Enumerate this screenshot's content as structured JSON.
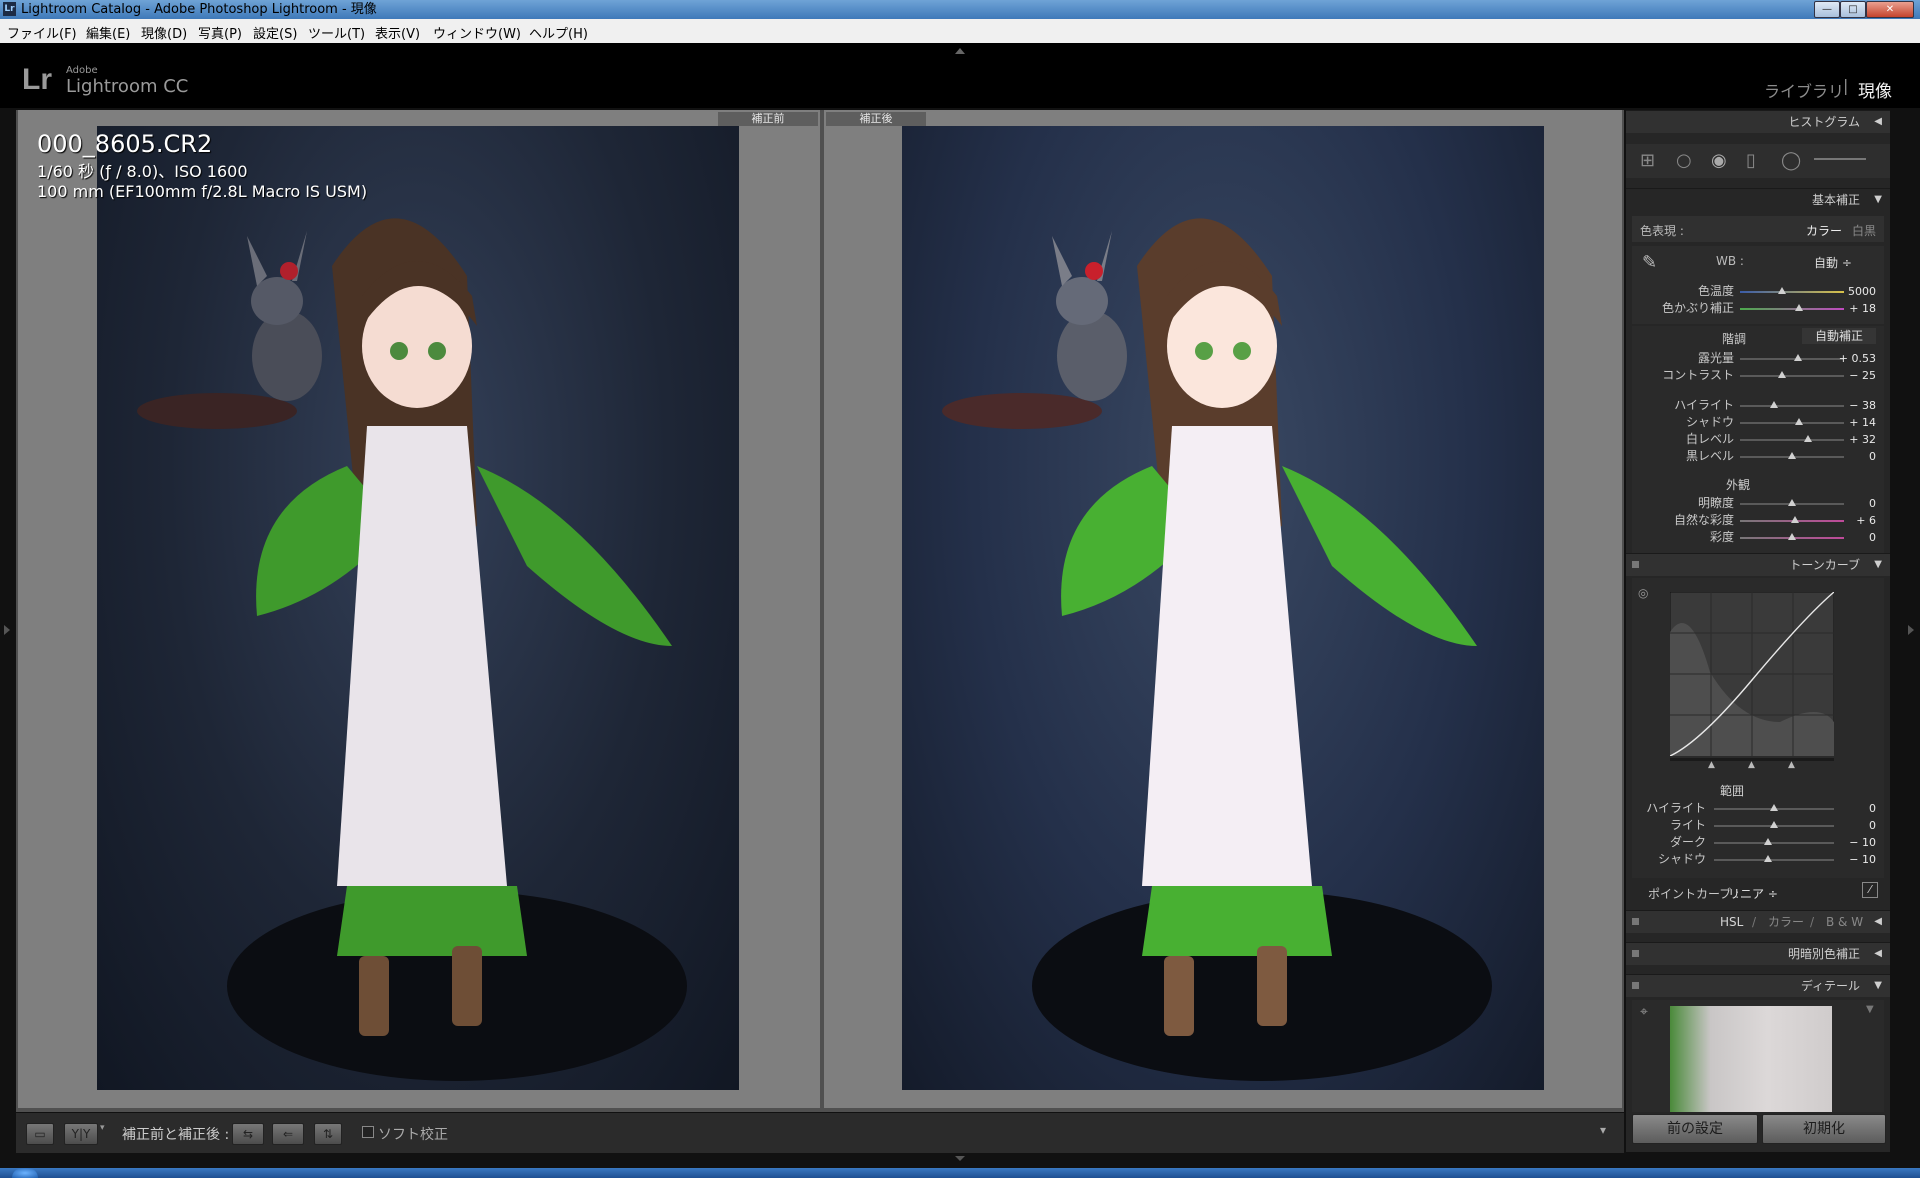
{
  "window": {
    "title": "Lightroom Catalog - Adobe Photoshop Lightroom - 現像",
    "app_icon": "Lr"
  },
  "menu": [
    "ファイル(F)",
    "編集(E)",
    "現像(D)",
    "写真(P)",
    "設定(S)",
    "ツール(T)",
    "表示(V)",
    "ウィンドウ(W)",
    "ヘルプ(H)"
  ],
  "identity": {
    "logo": "Lr",
    "brand_small": "Adobe",
    "brand_name": "Lightroom CC",
    "modules": [
      "ライブラリ",
      "現像"
    ],
    "separator": "|",
    "active_module": "現像"
  },
  "view": {
    "before_label": "補正前",
    "after_label": "補正後",
    "info_filename": "000_8605.CR2",
    "info_exposure": "1/60 秒 (ƒ / 8.0)、ISO 1600",
    "info_lens": "100 mm (EF100mm f/2.8L Macro IS USM)"
  },
  "toolbar": {
    "view_mode_label": "補正前と補正後 :",
    "yy_label": "Y|Y",
    "soft_proof_label": "ソフト校正",
    "soft_proof_checked": false
  },
  "panel": {
    "histogram": "ヒストグラム",
    "basic": "基本補正",
    "treatment_label": "色表現 :",
    "treatment_color": "カラー",
    "treatment_bw": "白黒",
    "wb_label": "WB :",
    "wb_value": "自動 ÷",
    "temp_label": "色温度",
    "temp_value": "5000",
    "tint_label": "色かぶり補正",
    "tint_value": "+ 18",
    "tone_title": "階調",
    "auto_label": "自動補正",
    "exposure_label": "露光量",
    "exposure_value": "+ 0.53",
    "contrast_label": "コントラスト",
    "contrast_value": "− 25",
    "highlights_label": "ハイライト",
    "highlights_value": "− 38",
    "shadows_label": "シャドウ",
    "shadows_value": "+ 14",
    "whites_label": "白レベル",
    "whites_value": "+ 32",
    "blacks_label": "黒レベル",
    "blacks_value": "0",
    "presence_title": "外観",
    "clarity_label": "明瞭度",
    "clarity_value": "0",
    "vibrance_label": "自然な彩度",
    "vibrance_value": "+ 6",
    "saturation_label": "彩度",
    "saturation_value": "0",
    "tone_curve": "トーンカーブ",
    "region_title": "範囲",
    "r_highlights_label": "ハイライト",
    "r_highlights_value": "0",
    "r_lights_label": "ライト",
    "r_lights_value": "0",
    "r_darks_label": "ダーク",
    "r_darks_value": "− 10",
    "r_shadows_label": "シャドウ",
    "r_shadows_value": "− 10",
    "point_curve_label": "ポイントカーブ :",
    "point_curve_value": "リニア ÷",
    "hsl": "HSL",
    "hsl_color": "カラー",
    "hsl_bw": "B & W",
    "hsl_sep": "/",
    "split_toning": "明暗別色補正",
    "detail": "ディテール",
    "prev_button": "前の設定",
    "reset_button": "初期化"
  },
  "sliders": {
    "temp": 0.4,
    "tint": 0.57,
    "exposure": 0.56,
    "contrast": 0.4,
    "highlights": 0.33,
    "shadows": 0.57,
    "whites": 0.65,
    "blacks": 0.5,
    "clarity": 0.5,
    "vibrance": 0.53,
    "saturation": 0.5,
    "r_highlights": 0.5,
    "r_lights": 0.5,
    "r_darks": 0.45,
    "r_shadows": 0.45
  },
  "colors": {
    "accent": "#3e79b9",
    "panel_bg": "#262626",
    "photo_bg": "#1e2636",
    "dress_green": "#3f9a2c",
    "apron": "#e9e4ea"
  }
}
